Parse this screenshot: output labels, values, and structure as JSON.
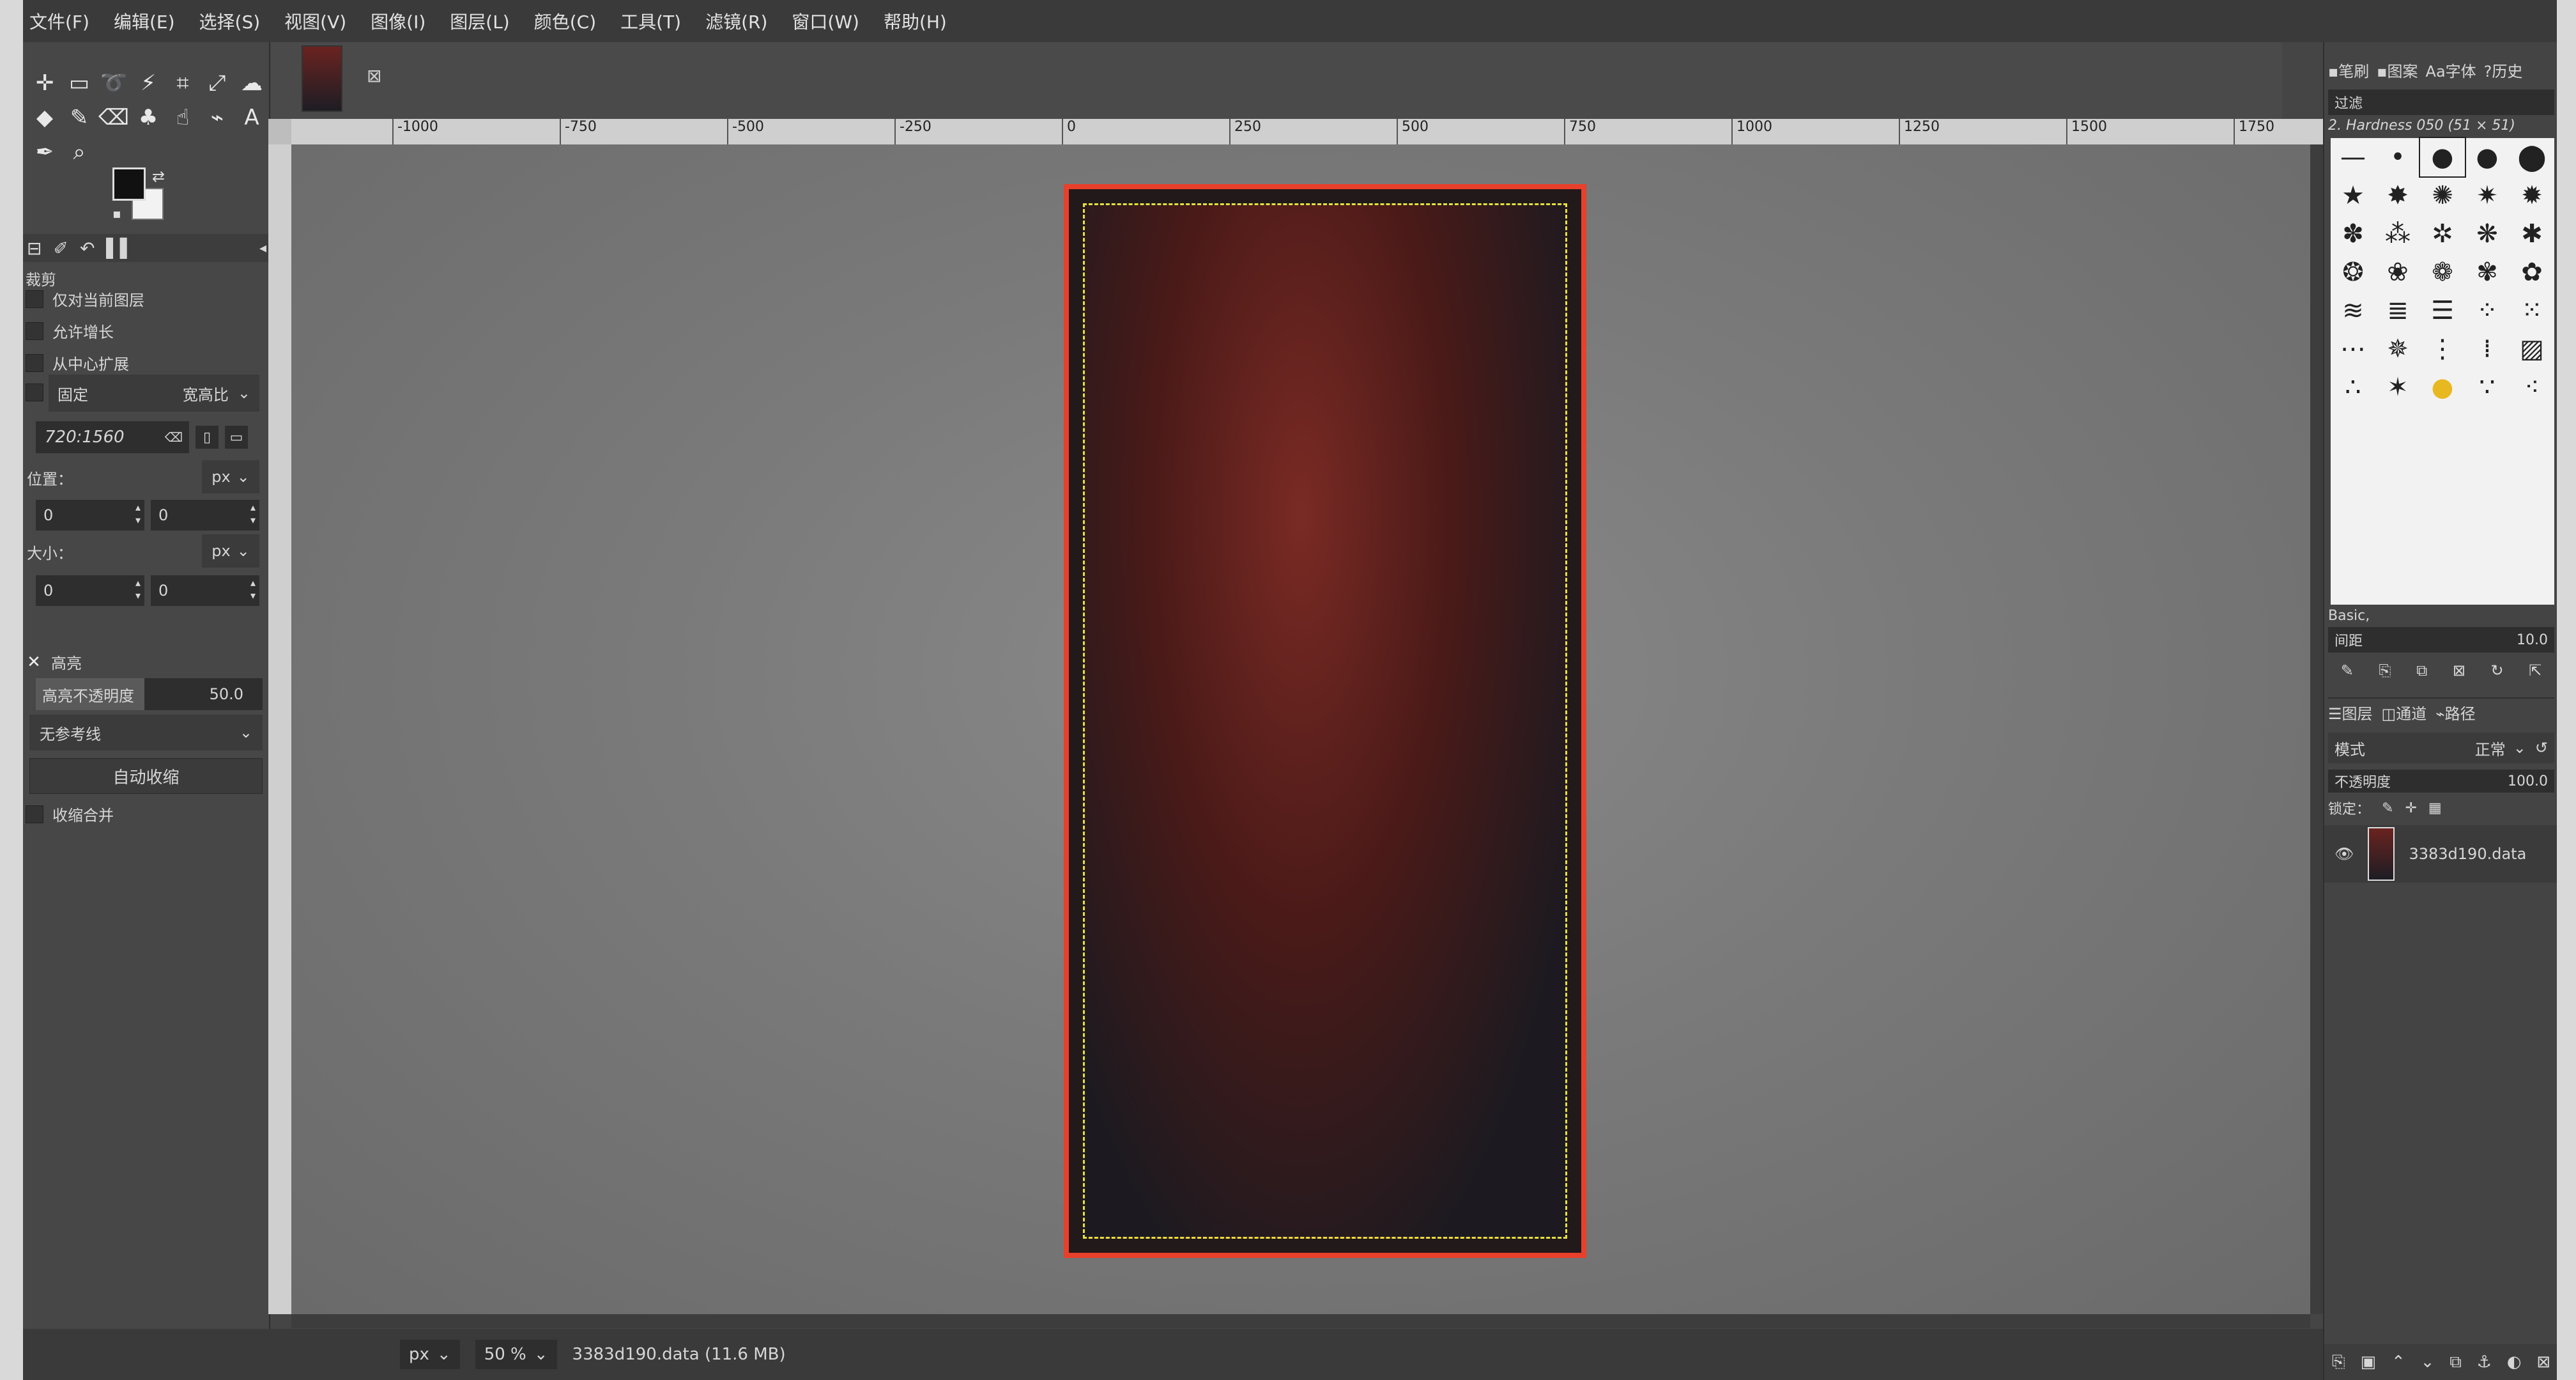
{
  "menu": [
    "文件(F)",
    "编辑(E)",
    "选择(S)",
    "视图(V)",
    "图像(I)",
    "图层(L)",
    "颜色(C)",
    "工具(T)",
    "滤镜(R)",
    "窗口(W)",
    "帮助(H)"
  ],
  "toolbox": {
    "tool_icons": [
      "move-icon",
      "rect-select-icon",
      "lasso-icon",
      "fuzzy-select-icon",
      "crop-icon",
      "unified-transform-icon",
      "warp-icon",
      "bucket-fill-icon",
      "paintbrush-icon",
      "eraser-icon",
      "clone-icon",
      "smudge-icon",
      "paths-icon",
      "text-icon",
      "color-picker-icon",
      "zoom-icon"
    ],
    "options_title": "裁剪",
    "only_current_layer": "仅对当前图层",
    "allow_growing": "允许增长",
    "expand_from_center": "从中心扩展",
    "fixed_label": "固定",
    "aspect_label": "宽高比",
    "ratio_value": "720:1560",
    "position_label": "位置：",
    "position_unit": "px",
    "position_x": "0",
    "position_y": "0",
    "size_label": "大小：",
    "size_unit": "px",
    "size_w": "0",
    "size_h": "0",
    "highlight_label": "高亮",
    "highlight_opacity_label": "高亮不透明度",
    "highlight_opacity_value": "50.0",
    "guides_value": "无参考线",
    "auto_shrink_button": "自动收缩",
    "shrink_merged": "收缩合并"
  },
  "canvas": {
    "ruler_ticks": [
      "-1000",
      "-750",
      "-500",
      "-250",
      "0",
      "250",
      "500",
      "750",
      "1000",
      "1250",
      "1500",
      "1750"
    ]
  },
  "status": {
    "unit": "px",
    "zoom": "50 %",
    "file_info": "3383d190.data (11.6 MB)"
  },
  "dock": {
    "tabs": [
      "笔刷",
      "图案",
      "字体",
      "历史"
    ],
    "filter_placeholder": "过滤",
    "brush_name": "2. Hardness 050 (51 × 51)",
    "brush_set": "Basic,",
    "spacing_label": "间距",
    "spacing_value": "10.0",
    "layer_tabs": [
      "图层",
      "通道",
      "路径"
    ],
    "mode_label": "模式",
    "mode_value": "正常",
    "opacity_label": "不透明度",
    "opacity_value": "100.0",
    "lock_label": "锁定：",
    "layer_name": "3383d190.data"
  },
  "colors": {
    "selection_border": "#e8402a",
    "marching_ants": "#e6e23a",
    "ui_dark": "#454545"
  }
}
